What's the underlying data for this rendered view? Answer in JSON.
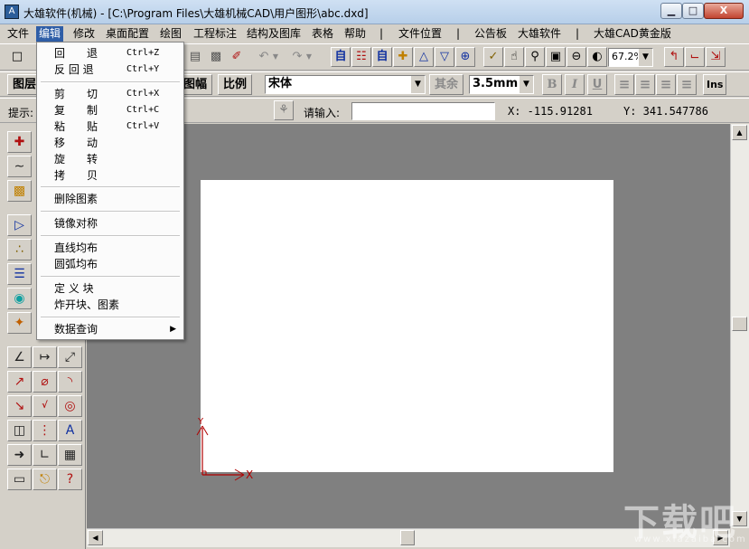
{
  "window": {
    "title": "大雄软件(机械) - [C:\\Program Files\\大雄机械CAD\\用户图形\\abc.dxd]",
    "min_label": "▁",
    "max_label": "□",
    "close_label": "X"
  },
  "menubar": [
    "文件",
    "编辑",
    "修改",
    "桌面配置",
    "绘图",
    "工程标注",
    "结构及图库",
    "表格",
    "帮助",
    "文件位置",
    "公告板",
    "大雄软件",
    "大雄CAD黄金版"
  ],
  "menubar_sep": "|",
  "toolbar2": {
    "layer_btn": "图层",
    "frame_btn": "图幅",
    "scale_btn": "比例",
    "font_value": "宋体",
    "other_btn": "其余",
    "size_value": "3.5mm",
    "bold": "B",
    "italic": "I",
    "underline": "U",
    "ins": "Ins"
  },
  "toolbar1": {
    "zoom_value": "67.2%"
  },
  "statusbar": {
    "hint_label": "提示:",
    "input_label": "请输入:",
    "input_value": "",
    "x_readout": "X: -115.91281",
    "y_readout": "Y: 341.547786"
  },
  "edit_menu": {
    "items": [
      {
        "label": "回　　退",
        "shortcut": "Ctrl+Z"
      },
      {
        "label": "反 回 退",
        "shortcut": "Ctrl+Y"
      },
      {
        "label": "剪　　切",
        "shortcut": "Ctrl+X"
      },
      {
        "label": "复　　制",
        "shortcut": "Ctrl+C"
      },
      {
        "label": "粘　　贴",
        "shortcut": "Ctrl+V"
      },
      {
        "label": "移　　动",
        "shortcut": ""
      },
      {
        "label": "旋　　转",
        "shortcut": ""
      },
      {
        "label": "拷　　贝",
        "shortcut": ""
      },
      {
        "label": "删除图素",
        "shortcut": ""
      },
      {
        "label": "镜像对称",
        "shortcut": ""
      },
      {
        "label": "直线均布",
        "shortcut": ""
      },
      {
        "label": "圆弧均布",
        "shortcut": ""
      },
      {
        "label": "定 义 块",
        "shortcut": ""
      },
      {
        "label": "炸开块、图素",
        "shortcut": ""
      },
      {
        "label": "数据查询",
        "shortcut": ""
      }
    ]
  },
  "canvas": {
    "axis_y_label": "Y",
    "axis_x_label": "X"
  },
  "watermark": {
    "text": "下载吧",
    "url": "www.xiazaiba.com"
  },
  "colors": {
    "menu_highlight": "#2f5ea7",
    "canvas_bg": "#808080",
    "paper": "#ffffff",
    "axis": "#b00000"
  }
}
